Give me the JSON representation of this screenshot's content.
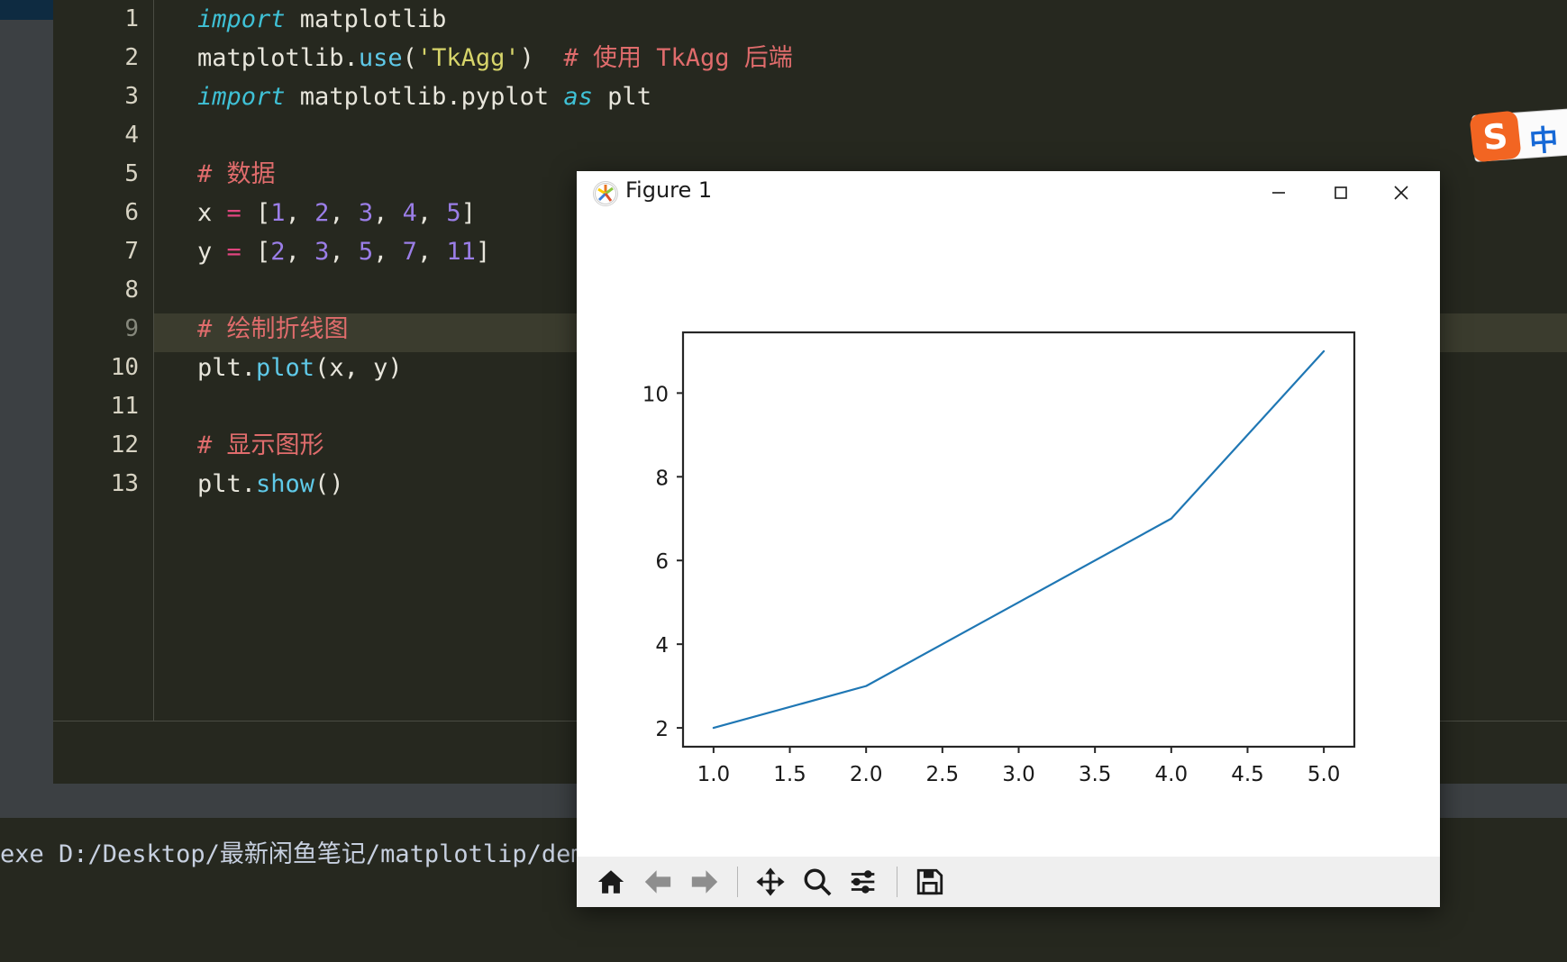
{
  "editor": {
    "language": "python",
    "highlighted_line": 9,
    "lines": [
      {
        "n": "1",
        "tokens": [
          {
            "t": "import",
            "c": "kw"
          },
          {
            "t": " matplotlib",
            "c": "plain"
          }
        ]
      },
      {
        "n": "2",
        "tokens": [
          {
            "t": "matplotlib.",
            "c": "plain"
          },
          {
            "t": "use",
            "c": "fn"
          },
          {
            "t": "(",
            "c": "plain"
          },
          {
            "t": "'TkAgg'",
            "c": "str"
          },
          {
            "t": ")",
            "c": "plain"
          },
          {
            "t": "  ",
            "c": "plain"
          },
          {
            "t": "# 使用 TkAgg 后端",
            "c": "cmt"
          }
        ]
      },
      {
        "n": "3",
        "tokens": [
          {
            "t": "import",
            "c": "kw"
          },
          {
            "t": " matplotlib.pyplot ",
            "c": "plain"
          },
          {
            "t": "as",
            "c": "kw"
          },
          {
            "t": " plt",
            "c": "plain"
          }
        ]
      },
      {
        "n": "4",
        "tokens": []
      },
      {
        "n": "5",
        "tokens": [
          {
            "t": "# 数据",
            "c": "cmt"
          }
        ]
      },
      {
        "n": "6",
        "tokens": [
          {
            "t": "x ",
            "c": "plain"
          },
          {
            "t": "=",
            "c": "op"
          },
          {
            "t": " [",
            "c": "plain"
          },
          {
            "t": "1",
            "c": "num"
          },
          {
            "t": ", ",
            "c": "plain"
          },
          {
            "t": "2",
            "c": "num"
          },
          {
            "t": ", ",
            "c": "plain"
          },
          {
            "t": "3",
            "c": "num"
          },
          {
            "t": ", ",
            "c": "plain"
          },
          {
            "t": "4",
            "c": "num"
          },
          {
            "t": ", ",
            "c": "plain"
          },
          {
            "t": "5",
            "c": "num"
          },
          {
            "t": "]",
            "c": "plain"
          }
        ]
      },
      {
        "n": "7",
        "tokens": [
          {
            "t": "y ",
            "c": "plain"
          },
          {
            "t": "=",
            "c": "op"
          },
          {
            "t": " [",
            "c": "plain"
          },
          {
            "t": "2",
            "c": "num"
          },
          {
            "t": ", ",
            "c": "plain"
          },
          {
            "t": "3",
            "c": "num"
          },
          {
            "t": ", ",
            "c": "plain"
          },
          {
            "t": "5",
            "c": "num"
          },
          {
            "t": ", ",
            "c": "plain"
          },
          {
            "t": "7",
            "c": "num"
          },
          {
            "t": ", ",
            "c": "plain"
          },
          {
            "t": "11",
            "c": "num"
          },
          {
            "t": "]",
            "c": "plain"
          }
        ]
      },
      {
        "n": "8",
        "tokens": []
      },
      {
        "n": "9",
        "tokens": [
          {
            "t": "# 绘制折线图",
            "c": "cmt"
          }
        ]
      },
      {
        "n": "10",
        "tokens": [
          {
            "t": "plt.",
            "c": "plain"
          },
          {
            "t": "plot",
            "c": "fn"
          },
          {
            "t": "(x, y)",
            "c": "plain"
          }
        ]
      },
      {
        "n": "11",
        "tokens": []
      },
      {
        "n": "12",
        "tokens": [
          {
            "t": "# 显示图形",
            "c": "cmt"
          }
        ]
      },
      {
        "n": "13",
        "tokens": [
          {
            "t": "plt.",
            "c": "plain"
          },
          {
            "t": "show",
            "c": "fn"
          },
          {
            "t": "()",
            "c": "plain"
          }
        ]
      }
    ]
  },
  "terminal": {
    "output_line": "exe D:/Desktop/最新闲鱼笔记/matplotlip/dem"
  },
  "ime": {
    "name": "sogou-input-method",
    "logo_letter": "S",
    "mode": "中",
    "logo_color": "#f26522",
    "mode_color": "#1769d6"
  },
  "figure_window": {
    "title": "Figure 1",
    "icon": "matplotlib-icon",
    "controls": {
      "minimize": "minimize-icon",
      "maximize": "maximize-icon",
      "close": "close-icon"
    },
    "toolbar": [
      {
        "name": "home-button",
        "icon": "home-icon",
        "tooltip": "Reset original view",
        "enabled": true
      },
      {
        "name": "back-button",
        "icon": "arrow-left-icon",
        "tooltip": "Back to previous view",
        "enabled": false
      },
      {
        "name": "forward-button",
        "icon": "arrow-right-icon",
        "tooltip": "Forward to next view",
        "enabled": false
      },
      {
        "name": "pan-button",
        "icon": "move-icon",
        "tooltip": "Pan axes with left mouse, zoom with right",
        "enabled": true
      },
      {
        "name": "zoom-button",
        "icon": "magnifier-icon",
        "tooltip": "Zoom to rectangle",
        "enabled": true
      },
      {
        "name": "subplots-button",
        "icon": "sliders-icon",
        "tooltip": "Configure subplots",
        "enabled": true
      },
      {
        "name": "save-button",
        "icon": "floppy-disk-icon",
        "tooltip": "Save the figure",
        "enabled": true
      }
    ]
  },
  "chart_data": {
    "type": "line",
    "title": "",
    "xlabel": "",
    "ylabel": "",
    "x": [
      1,
      2,
      3,
      4,
      5
    ],
    "y": [
      2,
      3,
      5,
      7,
      11
    ],
    "series": [
      {
        "name": "",
        "values": [
          2,
          3,
          5,
          7,
          11
        ]
      }
    ],
    "line_color": "#1f77b4",
    "line_width": 2.2,
    "xlim": [
      0.8,
      5.2
    ],
    "ylim": [
      1.55,
      11.45
    ],
    "xticks": [
      "1.0",
      "1.5",
      "2.0",
      "2.5",
      "3.0",
      "3.5",
      "4.0",
      "4.5",
      "5.0"
    ],
    "xtick_values": [
      1.0,
      1.5,
      2.0,
      2.5,
      3.0,
      3.5,
      4.0,
      4.5,
      5.0
    ],
    "yticks": [
      "2",
      "4",
      "6",
      "8",
      "10"
    ],
    "ytick_values": [
      2,
      4,
      6,
      8,
      10
    ],
    "grid": false,
    "legend": null
  }
}
